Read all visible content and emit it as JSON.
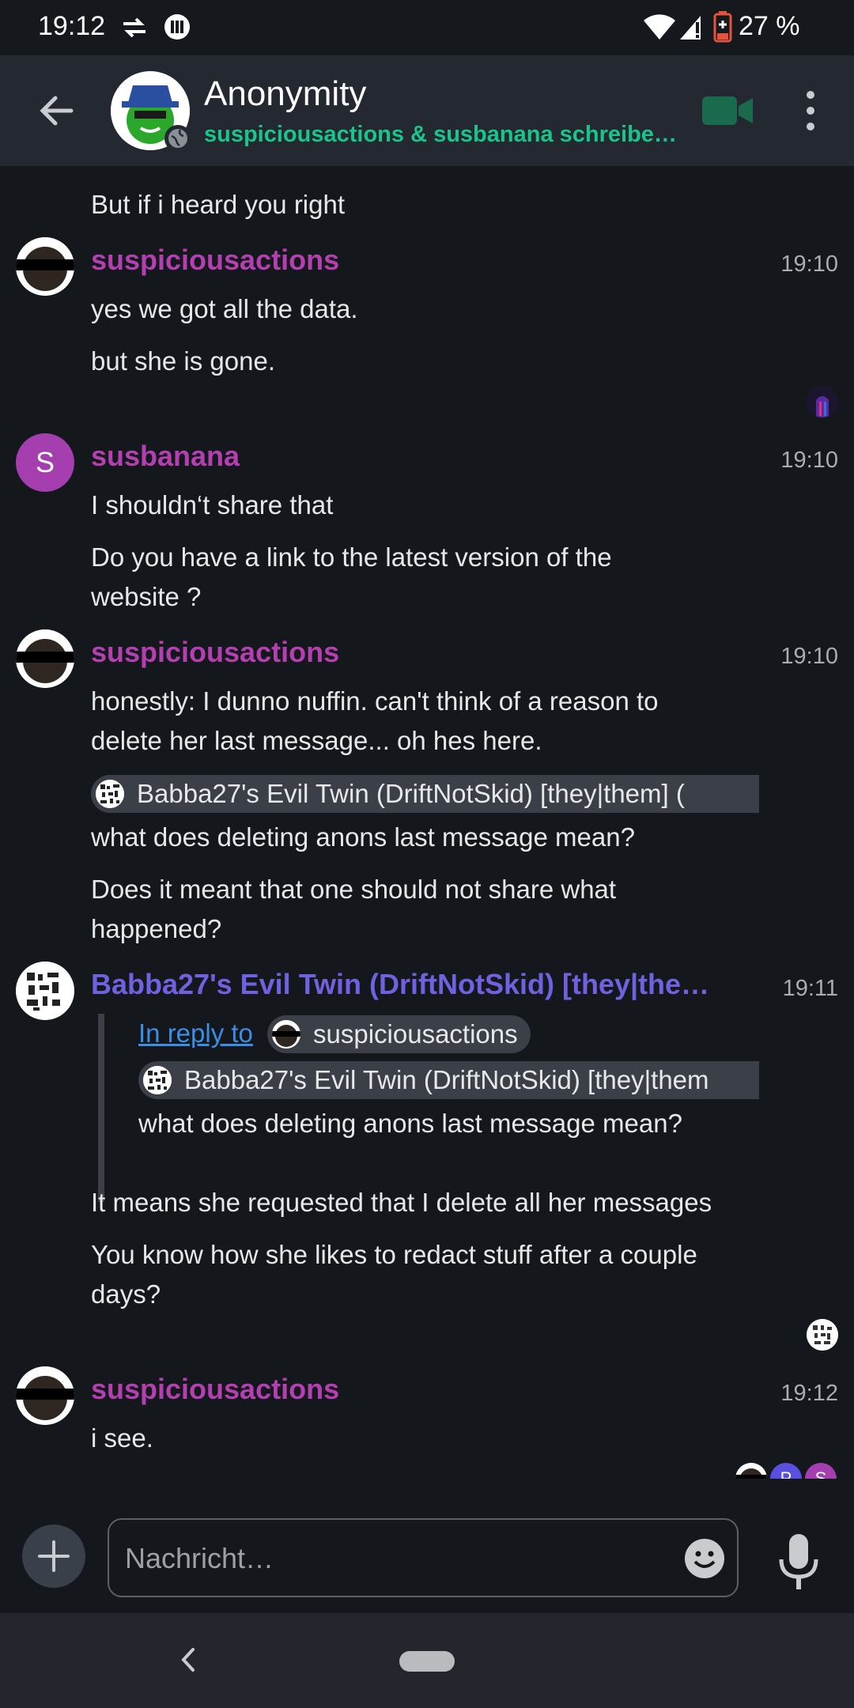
{
  "status_bar": {
    "time": "19:12",
    "battery": "27 %"
  },
  "header": {
    "room_name": "Anonymity",
    "typing_status": "suspiciousactions & susbanana schreibe…"
  },
  "timeline": {
    "m0_tail": "But if i heard you right",
    "g1": {
      "sender": "suspiciousactions",
      "time": "19:10",
      "l1": "yes we got all the data.",
      "l2": "but she is gone."
    },
    "g2": {
      "sender": "susbanana",
      "avatar_letter": "S",
      "time": "19:10",
      "l1": "I shouldn‘t share that",
      "l2": "Do you have a link to the latest version of the website ?"
    },
    "g3": {
      "sender": "suspiciousactions",
      "time": "19:10",
      "l1": "honestly: I dunno nuffin. can't think of a reason to delete her last message... oh hes here.",
      "pill": "Babba27's Evil Twin (DriftNotSkid) [they|them] (",
      "l2": "what does deleting anons last message mean?",
      "l3": "Does it meant that one should not share what happened?"
    },
    "g4": {
      "sender": "Babba27's Evil Twin (DriftNotSkid) [they|the…",
      "time": "19:11",
      "reply_label": "In reply to",
      "reply_user": "suspiciousactions",
      "quote_pill": "Babba27's Evil Twin (DriftNotSkid) [they|them",
      "quote_text": "what does deleting anons last message mean?",
      "l1": "It means she requested that I delete all her messages",
      "l2": "You know how she likes to redact stuff after a couple days?"
    },
    "g5": {
      "sender": "suspiciousactions",
      "time": "19:12",
      "l1": "i see."
    },
    "receipts": {
      "p": "P",
      "s": "S"
    }
  },
  "composer": {
    "placeholder": "Nachricht…"
  },
  "colors": {
    "sender_purple": "#b43fb0",
    "sender_blue": "#6f61e0",
    "typing_green": "#1bc48a",
    "link_blue": "#3a8ee6"
  }
}
